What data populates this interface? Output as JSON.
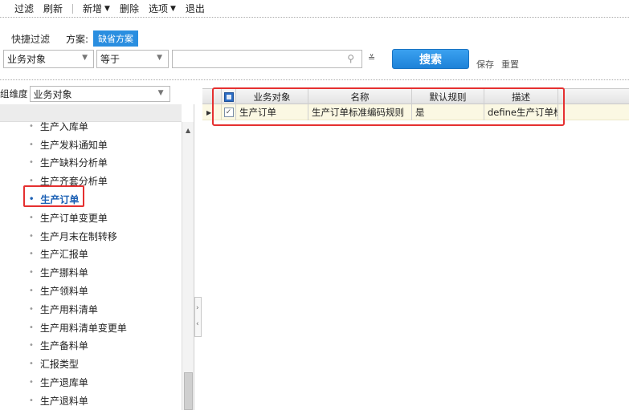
{
  "toolbar": {
    "items": [
      {
        "label": "过滤"
      },
      {
        "label": "刷新"
      },
      {
        "label": "新增",
        "has_dropdown": true
      },
      {
        "label": "删除"
      },
      {
        "label": "选项",
        "has_dropdown": true
      },
      {
        "label": "退出"
      }
    ]
  },
  "quick_filter": {
    "label": "快捷过滤",
    "scheme_label": "方案:",
    "scheme_value": "缺省方案"
  },
  "filter": {
    "field_value": "业务对象",
    "operator_value": "等于",
    "value_input": "",
    "search_button": "搜索",
    "save_link": "保存",
    "reset_link": "重置"
  },
  "left_panel": {
    "dimension_label": "组维度",
    "dimension_value": "业务对象",
    "tree_items": [
      "生产入库单",
      "生产发料通知单",
      "生产缺料分析单",
      "生产齐套分析单",
      "生产订单",
      "生产订单变更单",
      "生产月末在制转移",
      "生产汇报单",
      "生产挪料单",
      "生产领料单",
      "生产用料清单",
      "生产用料清单变更单",
      "生产备料单",
      "汇报类型",
      "生产退库单",
      "生产退料单"
    ],
    "selected_item": "生产订单"
  },
  "grid": {
    "columns": [
      "业务对象",
      "名称",
      "默认规则",
      "描述"
    ],
    "rows": [
      {
        "checked": true,
        "cells": [
          "生产订单",
          "生产订单标准编码规则",
          "是",
          "define生产订单标〉"
        ]
      }
    ]
  },
  "colors": {
    "accent": "#2a8ee0",
    "highlight_outline": "#e53030",
    "selected_row_bg": "#fbf8e3"
  }
}
